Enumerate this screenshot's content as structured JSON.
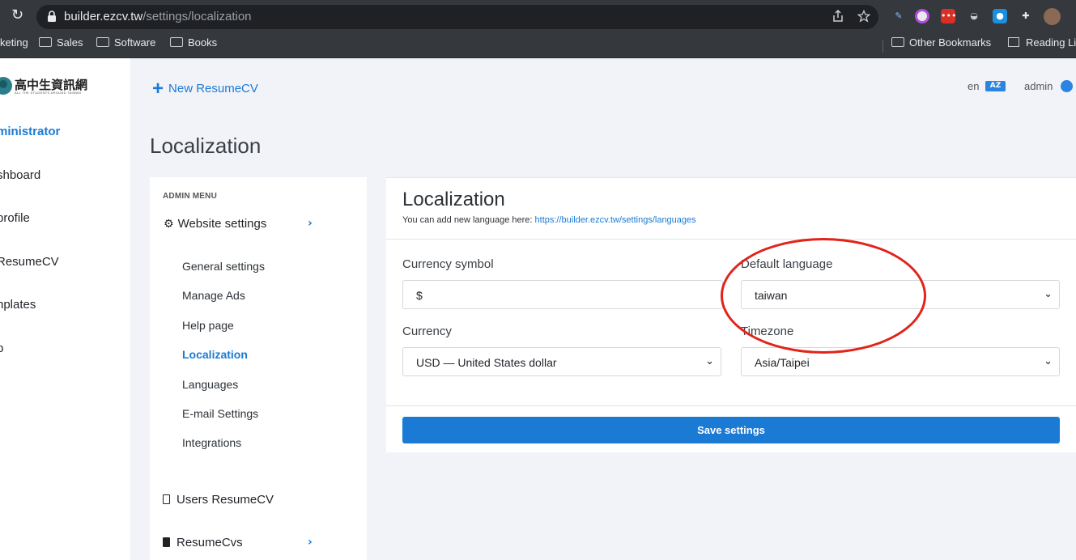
{
  "browser": {
    "url_domain": "builder.ezcv.tw",
    "url_path": "/settings/localization",
    "bookmarks": [
      "keting",
      "Sales",
      "Software",
      "Books"
    ],
    "bookmarks_right": [
      "Other Bookmarks",
      "Reading Li"
    ]
  },
  "app_sidebar": {
    "logo_text": "高中生資訊網",
    "logo_subtext": "ALL THE STUDENTS AROUND TAIWAN",
    "section": "ministrator",
    "items": [
      "shboard",
      "profile",
      "ResumeCV",
      "nplates",
      "p"
    ]
  },
  "header": {
    "new_resume": "New ResumeCV",
    "lang": "en",
    "lang_icon": "AZ",
    "user": "admin"
  },
  "page": {
    "title": "Localization"
  },
  "admin_menu": {
    "heading": "ADMIN MENU",
    "main": "Website settings",
    "sub_items": [
      "General settings",
      "Manage Ads",
      "Help page",
      "Localization",
      "Languages",
      "E-mail Settings",
      "Integrations"
    ],
    "active_index": 3,
    "users": "Users ResumeCV",
    "resumecvs": "ResumeCvs"
  },
  "settings": {
    "title": "Localization",
    "subtitle": "You can add new language here:",
    "link": "https://builder.ezcv.tw/settings/languages",
    "currency_symbol_label": "Currency symbol",
    "currency_symbol_value": "$",
    "default_language_label": "Default language",
    "default_language_value": "taiwan",
    "currency_label": "Currency",
    "currency_value": "USD — United States dollar",
    "timezone_label": "Timezone",
    "timezone_value": "Asia/Taipei",
    "save": "Save settings"
  },
  "colors": {
    "accent": "#1a7ad4",
    "annotation": "#e2231a"
  }
}
